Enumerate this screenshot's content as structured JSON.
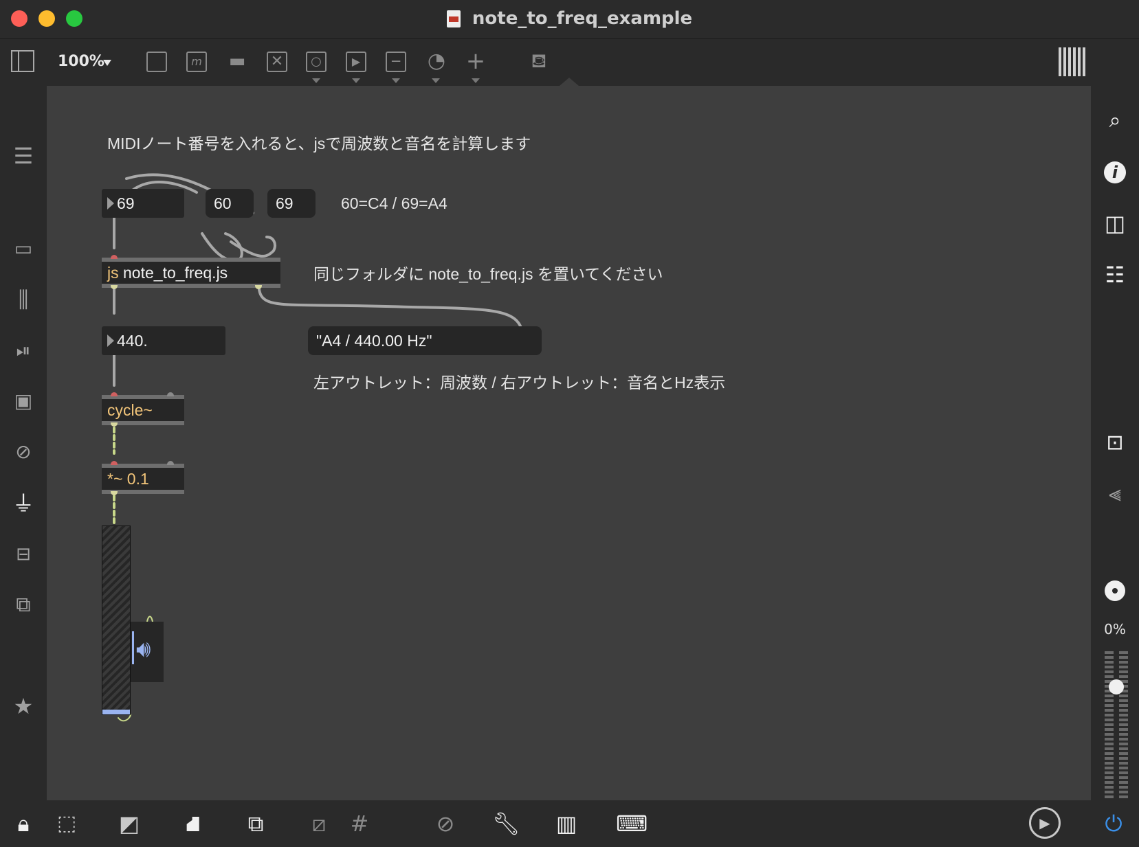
{
  "window": {
    "title": "note_to_freq_example",
    "traffic_lights": [
      "#fe5f57",
      "#febc2e",
      "#28c840"
    ]
  },
  "toolbar": {
    "zoom": "100%",
    "items": [
      "sidebar-toggle-icon",
      "zoom-select",
      "object-icon",
      "message-icon",
      "comment-icon",
      "toggle-icon",
      "button-icon",
      "play-icon",
      "slider-icon",
      "dial-icon",
      "add-icon",
      "paint-bucket-icon",
      "grid-icon"
    ]
  },
  "patch": {
    "comments": {
      "heading": "MIDIノート番号を入れると、jsで周波数と音名を計算します",
      "note_ref": "60=C4 / 69=A4",
      "js_hint": "同じフォルダに note_to_freq.js を置いてください",
      "outlet_hint": "左アウトレット：周波数 / 右アウトレット：音名とHz表示"
    },
    "note_number": "69",
    "msg_60": "60",
    "msg_69": "69",
    "js_object": {
      "keyword": "js",
      "arg": "note_to_freq.js"
    },
    "freq_number": "440.",
    "name_message": "\"A4 / 440.00 Hz\"",
    "cycle_object": "cycle~",
    "gain_object": "*~ 0.1",
    "colors": {
      "canvas": "#3e3e3e",
      "signal_patchcord": "#c8d88a",
      "control_patchcord": "#a8a8a8",
      "object_keyword": "#f2c57a"
    }
  },
  "right_sidebar": {
    "audio_level": "0%"
  }
}
